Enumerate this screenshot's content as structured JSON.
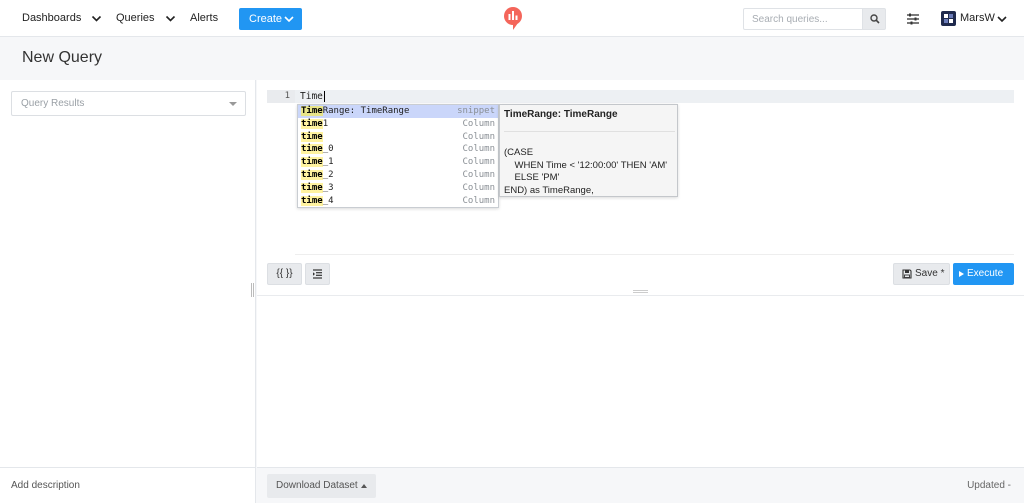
{
  "topnav": {
    "dashboards_label": "Dashboards",
    "queries_label": "Queries",
    "alerts_label": "Alerts",
    "create_label": "Create",
    "search_placeholder": "Search queries...",
    "username": "MarsW"
  },
  "page": {
    "title": "New Query"
  },
  "schema": {
    "placeholder": "Query Results"
  },
  "left_footer": {
    "add_description": "Add description"
  },
  "editor": {
    "line_number": "1",
    "code": "Time"
  },
  "autocomplete": {
    "items": [
      {
        "match": "Time",
        "rest": "Range: TimeRange",
        "meta": "snippet",
        "selected": true
      },
      {
        "match": "time",
        "rest": "1",
        "meta": "Column"
      },
      {
        "match": "time",
        "rest": "",
        "meta": "Column"
      },
      {
        "match": "time",
        "rest": "_0",
        "meta": "Column"
      },
      {
        "match": "time",
        "rest": "_1",
        "meta": "Column"
      },
      {
        "match": "time",
        "rest": "_2",
        "meta": "Column"
      },
      {
        "match": "time",
        "rest": "_3",
        "meta": "Column"
      },
      {
        "match": "time",
        "rest": "_4",
        "meta": "Column"
      }
    ],
    "doc_title": "TimeRange: TimeRange",
    "doc_body": "(CASE\n    WHEN Time < '12:00:00' THEN 'AM'\n    ELSE 'PM'\nEND) as TimeRange,"
  },
  "toolbar": {
    "params_label": "{{ }}",
    "save_label": "Save *",
    "execute_label": "Execute"
  },
  "bottom": {
    "download_label": "Download Dataset",
    "updated_label": "Updated -"
  },
  "colors": {
    "primary": "#2196f3",
    "logo": "#f4655a"
  },
  "icons": [
    "chevron-down-icon",
    "redash-logo-icon",
    "search-icon",
    "settings-sliders-icon",
    "avatar-icon",
    "save-icon",
    "play-icon",
    "format-icon"
  ]
}
